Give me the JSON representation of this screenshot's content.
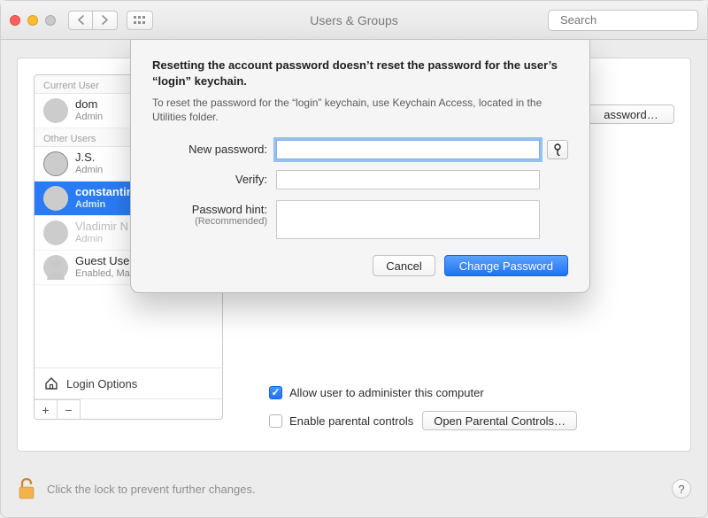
{
  "window": {
    "title": "Users & Groups",
    "search_placeholder": "Search"
  },
  "sidebar": {
    "section_current": "Current User",
    "section_other": "Other Users",
    "users": [
      {
        "name": "dom",
        "role": "Admin"
      },
      {
        "name": "J.S.",
        "role": "Admin"
      },
      {
        "name": "constantin",
        "role": "Admin"
      },
      {
        "name": "Vladimir N",
        "role": "Admin"
      },
      {
        "name": "Guest User",
        "role": "Enabled, Managed"
      }
    ],
    "login_options_label": "Login Options"
  },
  "right": {
    "reset_password_button": "assword…",
    "admin_checkbox_label": "Allow user to administer this computer",
    "parental_checkbox_label": "Enable parental controls",
    "open_parental_button": "Open Parental Controls…"
  },
  "lock_text": "Click the lock to prevent further changes.",
  "sheet": {
    "heading": "Resetting the account password doesn’t reset the password for the user’s “login” keychain.",
    "description": "To reset the password for the “login” keychain, use Keychain Access, located in the Utilities folder.",
    "labels": {
      "new_password": "New password:",
      "verify": "Verify:",
      "hint": "Password hint:",
      "hint_sub": "(Recommended)"
    },
    "buttons": {
      "cancel": "Cancel",
      "change": "Change Password"
    },
    "values": {
      "new_password": "",
      "verify": "",
      "hint": ""
    }
  }
}
